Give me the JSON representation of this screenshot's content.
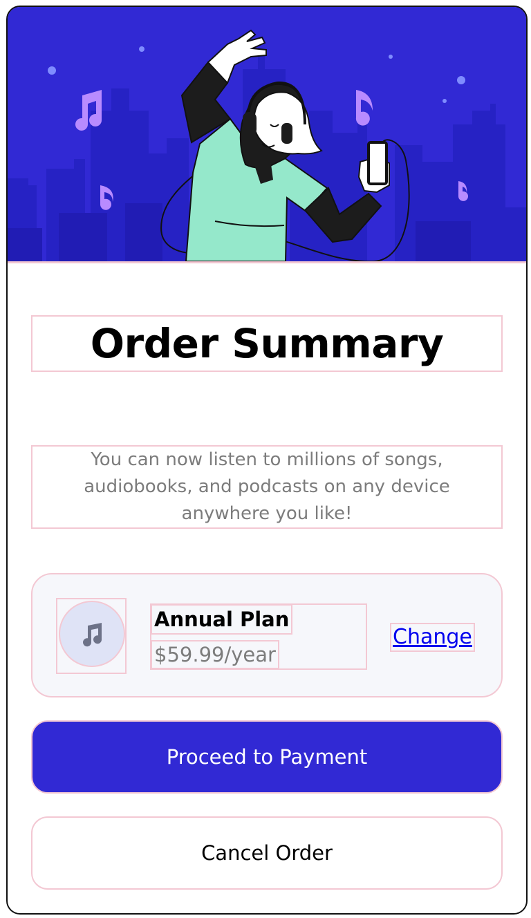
{
  "hero": {
    "illustration": "woman-listening-to-music-illustration",
    "background_color": "#3129d4"
  },
  "title": "Order Summary",
  "description": "You can now listen to millions of songs, audiobooks, and podcasts on any device anywhere you like!",
  "plan": {
    "icon": "music-note-icon",
    "name": "Annual Plan",
    "price": "$59.99/year",
    "change_label": "Change"
  },
  "actions": {
    "primary_label": "Proceed to Payment",
    "secondary_label": "Cancel Order"
  },
  "colors": {
    "accent": "#3129d4",
    "outline": "#f3c8d3",
    "muted_text": "#7c7c7c",
    "link": "#0000ee"
  }
}
